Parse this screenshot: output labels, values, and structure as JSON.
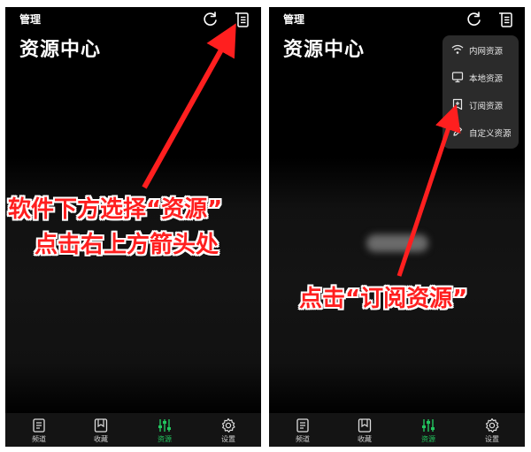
{
  "left_panel": {
    "manage_label": "管理",
    "title": "资源中心"
  },
  "right_panel": {
    "manage_label": "管理",
    "title": "资源中心",
    "menu": [
      "内网资源",
      "本地资源",
      "订阅资源",
      "自定义资源"
    ]
  },
  "tabs": [
    {
      "label": "频道",
      "icon": "document-icon"
    },
    {
      "label": "收藏",
      "icon": "bookmark-icon"
    },
    {
      "label": "资源",
      "icon": "sliders-icon",
      "active": true
    },
    {
      "label": "设置",
      "icon": "gear-icon"
    }
  ],
  "annotations": {
    "left_line1": "软件下方选择“资源”",
    "left_line2": "点击右上方箭头处",
    "right": "点击“订阅资源”"
  },
  "colors": {
    "annotation": "#ff1f1f",
    "active_tab": "#22c55e",
    "dropdown_bg": "#2b2b2b"
  }
}
